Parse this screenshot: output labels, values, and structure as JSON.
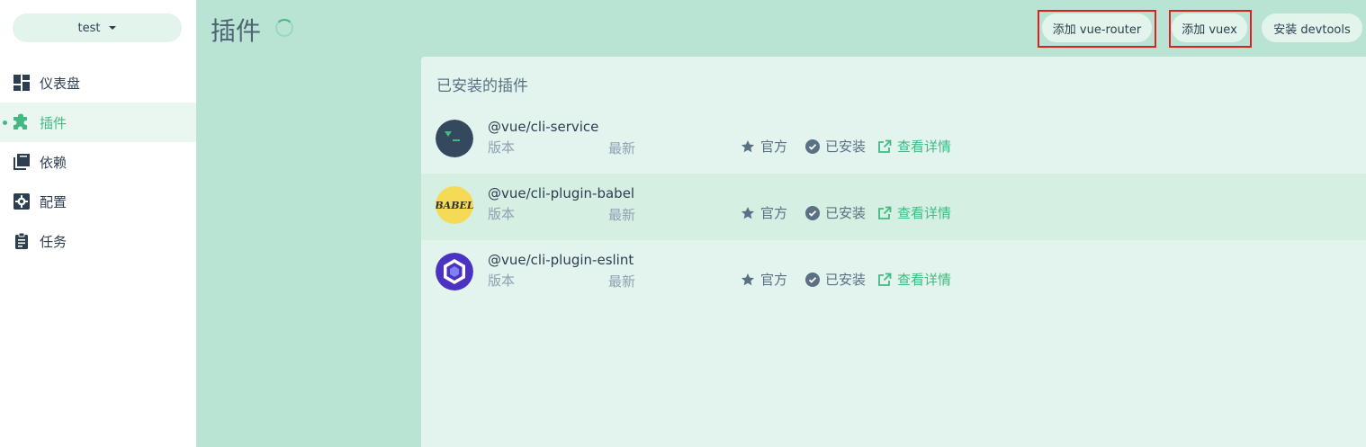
{
  "sidebar": {
    "project": "test",
    "items": [
      {
        "label": "仪表盘",
        "icon": "dashboard-icon",
        "active": false
      },
      {
        "label": "插件",
        "icon": "puzzle-icon",
        "active": true
      },
      {
        "label": "依赖",
        "icon": "library-icon",
        "active": false
      },
      {
        "label": "配置",
        "icon": "settings-icon",
        "active": false
      },
      {
        "label": "任务",
        "icon": "clipboard-icon",
        "active": false
      }
    ]
  },
  "header": {
    "title": "插件",
    "buttons": {
      "add_router": "添加 vue-router",
      "add_vuex": "添加 vuex",
      "install_devtools": "安装 devtools"
    }
  },
  "main": {
    "section_title": "已安装的插件",
    "plugins": [
      {
        "name": "@vue/cli-service",
        "version_label": "版本",
        "latest_label": "最新",
        "official": "官方",
        "installed": "已安装",
        "details": "查看详情",
        "logo": "cli-service-logo"
      },
      {
        "name": "@vue/cli-plugin-babel",
        "version_label": "版本",
        "latest_label": "最新",
        "official": "官方",
        "installed": "已安装",
        "details": "查看详情",
        "logo": "babel-logo"
      },
      {
        "name": "@vue/cli-plugin-eslint",
        "version_label": "版本",
        "latest_label": "最新",
        "official": "官方",
        "installed": "已安装",
        "details": "查看详情",
        "logo": "eslint-logo"
      }
    ]
  },
  "colors": {
    "accent": "#42b983",
    "highlight": "#e02020",
    "background": "#b9e4d3"
  }
}
